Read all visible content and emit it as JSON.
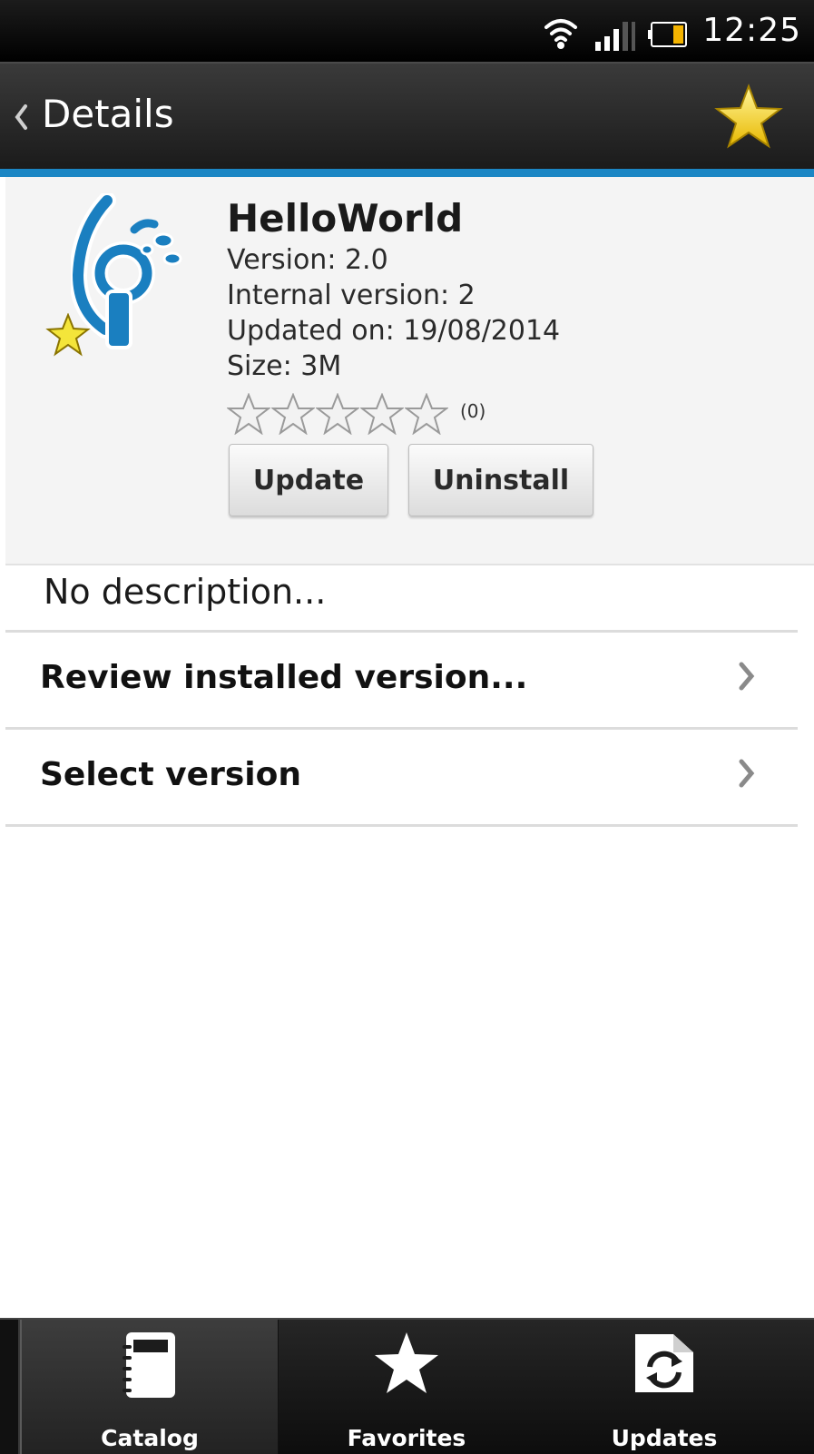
{
  "status_bar": {
    "time": "12:25",
    "icons": [
      "wifi-icon",
      "signal-icon",
      "battery-icon"
    ]
  },
  "action_bar": {
    "title": "Details",
    "back_icon": "chevron-left-icon",
    "favorite_icon": "star-icon"
  },
  "app": {
    "name": "HelloWorld",
    "version": "Version: 2.0",
    "internal_version": "Internal version: 2",
    "updated_on": "Updated on: 19/08/2014",
    "size": "Size: 3M",
    "rating": {
      "stars": 0,
      "max": 5,
      "count_label": "(0)"
    },
    "icon": "helloworld-app-icon",
    "is_favorite": true
  },
  "buttons": {
    "update": "Update",
    "uninstall": "Uninstall"
  },
  "description": "No description...",
  "list": [
    {
      "label": "Review installed version..."
    },
    {
      "label": "Select version"
    }
  ],
  "tabs": [
    {
      "label": "Catalog",
      "icon": "notebook-icon",
      "selected": true
    },
    {
      "label": "Favorites",
      "icon": "star-icon",
      "selected": false
    },
    {
      "label": "Updates",
      "icon": "refresh-folder-icon",
      "selected": false
    }
  ],
  "colors": {
    "accent": "#1b86c4",
    "star_gold": "#f4d320",
    "app_icon_blue": "#1a7fc0"
  }
}
